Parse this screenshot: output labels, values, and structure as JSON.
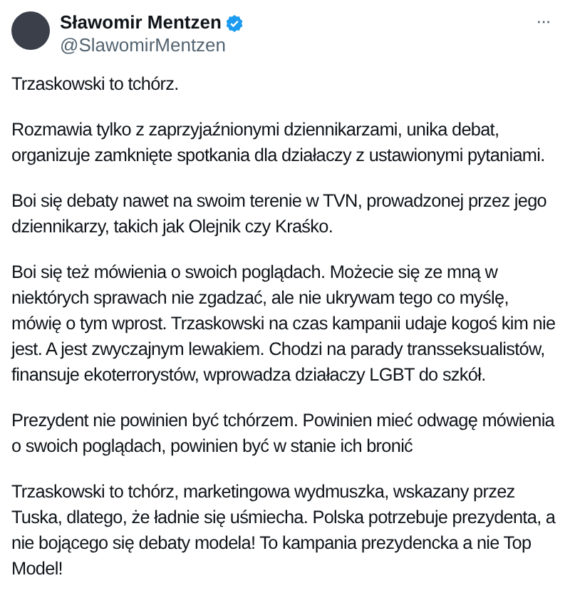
{
  "author": {
    "name": "Sławomir Mentzen",
    "verified": true,
    "handle": "@SlawomirMentzen"
  },
  "more_button": "···",
  "paragraphs": [
    "Trzaskowski to tchórz.",
    "Rozmawia tylko z zaprzyjaźnionymi dziennikarzami, unika debat, organizuje zamknięte spotkania dla działaczy z ustawionymi pytaniami.",
    "Boi się debaty nawet na swoim terenie w TVN, prowadzonej przez jego dziennikarzy, takich jak Olejnik czy Kraśko.",
    "Boi się też mówienia o swoich poglądach. Możecie się ze mną w niektórych sprawach nie zgadzać, ale nie ukrywam tego co myślę, mówię o tym wprost. Trzaskowski na czas kampanii udaje kogoś kim nie jest. A jest zwyczajnym lewakiem. Chodzi na parady transseksualistów, finansuje ekoterrorystów, wprowadza działaczy LGBT do szkół.",
    "Prezydent nie powinien być tchórzem. Powinien mieć odwagę mówienia o swoich poglądach, powinien być w stanie ich bronić",
    "Trzaskowski to tchórz, marketingowa wydmuszka, wskazany przez Tuska, dlatego, że ładnie się uśmiecha. Polska potrzebuje prezydenta, a nie bojącego się debaty modela! To kampania prezydencka a nie Top Model!"
  ]
}
